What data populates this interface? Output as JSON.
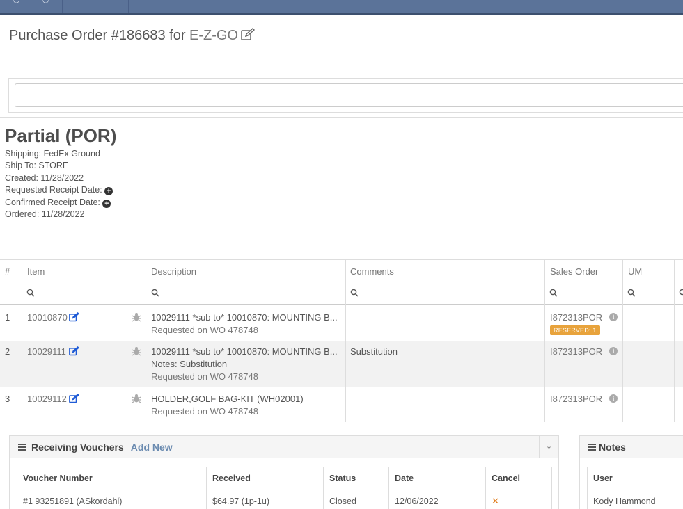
{
  "header": {
    "title_prefix": "Purchase Order #186683 for ",
    "vendor": "E-Z-GO"
  },
  "search": {
    "placeholder": ""
  },
  "status": {
    "title": "Partial (POR)",
    "shipping": "Shipping: FedEx Ground",
    "ship_to": "Ship To: STORE",
    "created": "Created: 11/28/2022",
    "requested_receipt": "Requested Receipt Date:",
    "confirmed_receipt": "Confirmed Receipt Date:",
    "ordered": "Ordered: 11/28/2022"
  },
  "grid": {
    "columns": [
      "#",
      "Item",
      "Description",
      "Comments",
      "Sales Order",
      "UM"
    ],
    "rows": [
      {
        "num": "1",
        "item": "10010870",
        "desc": "10029111 *sub to* 10010870: MOUNTING B...",
        "notes": "",
        "requested": "Requested on WO 478748",
        "comments": "",
        "sales_order": "I872313POR",
        "badge": "RESERVED: 1"
      },
      {
        "num": "2",
        "item": "10029111",
        "desc": "10029111 *sub to* 10010870: MOUNTING B...",
        "notes": "Notes: Substitution",
        "requested": "Requested on WO 478748",
        "comments": "Substitution",
        "sales_order": "I872313POR",
        "badge": ""
      },
      {
        "num": "3",
        "item": "10029112",
        "desc": "HOLDER,GOLF BAG-KIT (WH02001)",
        "notes": "",
        "requested": "Requested on WO 478748",
        "comments": "",
        "sales_order": "I872313POR",
        "badge": ""
      }
    ]
  },
  "vouchers": {
    "title": "Receiving Vouchers",
    "add_new": "Add New",
    "columns": [
      "Voucher Number",
      "Received",
      "Status",
      "Date",
      "Cancel"
    ],
    "rows": [
      {
        "voucher": "#1 93251891 (ASkordahl)",
        "received": "$64.97 (1p-1u)",
        "status": "Closed",
        "date": "12/06/2022"
      }
    ]
  },
  "notes": {
    "title": "Notes",
    "columns": [
      "User"
    ],
    "rows": [
      {
        "user": "Kody Hammond"
      }
    ]
  },
  "colors": {
    "topbar": "#5b7399",
    "accent_blue": "#1f5bd6",
    "badge": "#e8a33c",
    "cancel": "#e07b1a"
  }
}
